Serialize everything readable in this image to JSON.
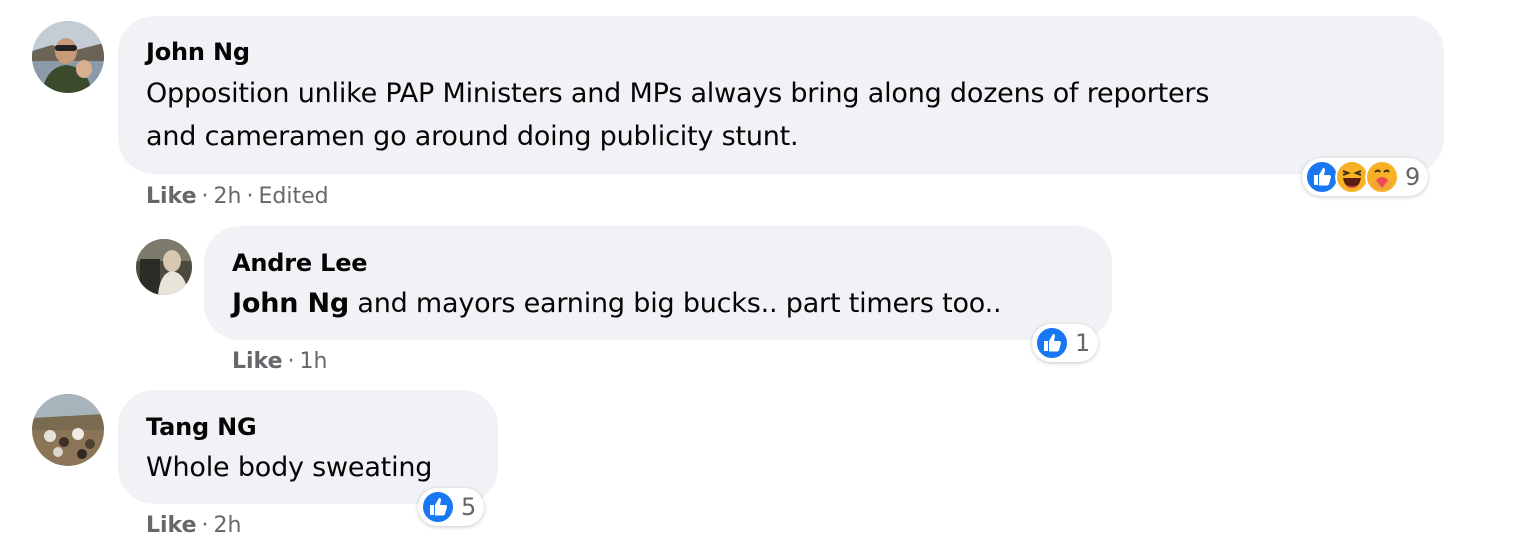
{
  "comments": [
    {
      "author": "John Ng",
      "text_line1": "Opposition unlike PAP Ministers and MPs always bring along dozens of reporters",
      "text_line2": "and cameramen go around doing publicity stunt.",
      "like_label": "Like",
      "time": "2h",
      "edited": "Edited",
      "reaction_count": "9",
      "reactions": [
        "like-icon",
        "haha-icon",
        "care-icon"
      ],
      "reply": {
        "author": "Andre Lee",
        "mention": "John Ng",
        "text": " and mayors earning big bucks.. part timers too..",
        "like_label": "Like",
        "time": "1h",
        "reaction_count": "1",
        "reactions": [
          "like-icon"
        ]
      }
    },
    {
      "author": "Tang NG",
      "text": "Whole body sweating",
      "like_label": "Like",
      "time": "2h",
      "reaction_count": "5",
      "reactions": [
        "like-icon"
      ]
    }
  ],
  "colors": {
    "bubble": "#f0f2f5",
    "like_blue": "#1877f2",
    "meta_gray": "#65676b",
    "haha_yellow": "#f7b125"
  }
}
